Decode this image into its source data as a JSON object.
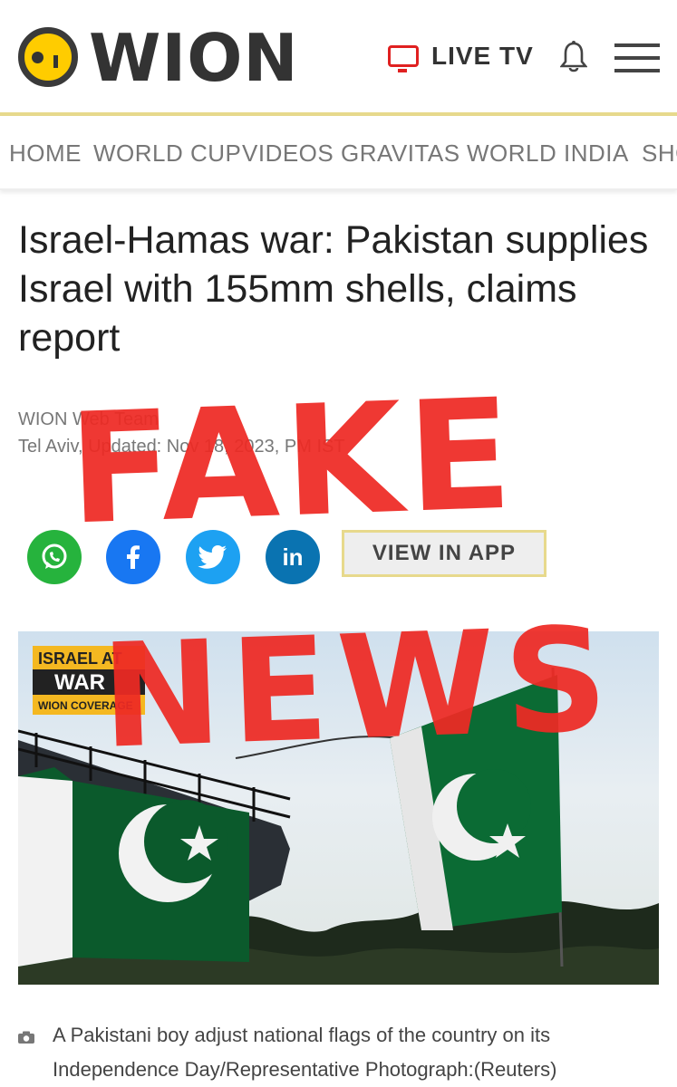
{
  "header": {
    "logo_text": "WION",
    "live_tv_label": "LIVE TV"
  },
  "nav": {
    "items": [
      "HOME",
      "WORLD CUP",
      "VIDEOS",
      "GRAVITAS",
      "WORLD",
      "INDIA",
      "SHO"
    ]
  },
  "article": {
    "headline": "Israel-Hamas war: Pakistan supplies Israel with 155mm shells, claims report",
    "byline": "WION Web Team",
    "dateline": "Tel Aviv, Updated: Nov 18, 2023, PM IST",
    "share_buttons": [
      "whatsapp-icon",
      "facebook-icon",
      "twitter-icon",
      "linkedin-icon"
    ],
    "view_in_app_label": "VIEW IN APP",
    "photo_badge": {
      "line1": "ISRAEL AT",
      "line2": "WAR",
      "line3": "WION COVERAGE"
    },
    "caption": "A Pakistani boy adjust national flags of the country on its Independence Day/Representative Photograph:(Reuters)"
  },
  "overlay": {
    "word1": "FAKE",
    "word2": "NEWS"
  },
  "colors": {
    "brand_yellow": "#ffcc00",
    "live_red": "#e02020",
    "stamp_red": "#ee2a24",
    "whatsapp": "#26b33d",
    "facebook": "#1877f2",
    "twitter": "#1da1f2",
    "linkedin": "#0a73b1",
    "flag_green": "#0b6b34"
  }
}
